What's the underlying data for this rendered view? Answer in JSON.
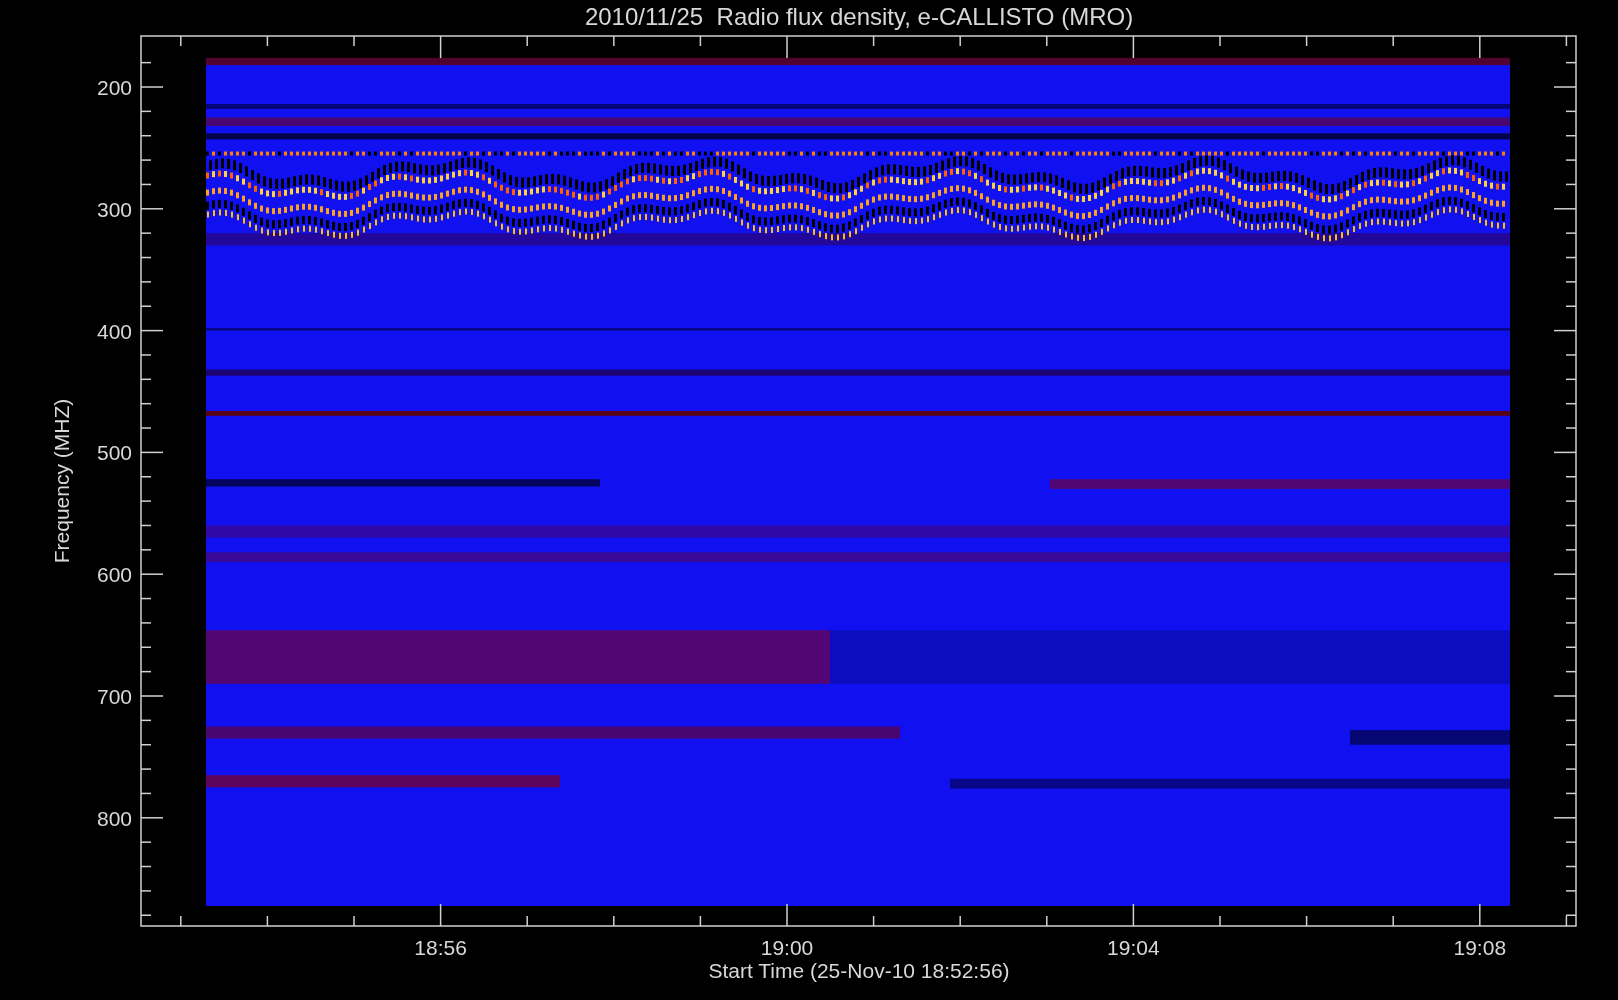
{
  "plot": {
    "title": "2010/11/25  Radio flux density, e-CALLISTO (MRO)",
    "y_axis": {
      "label": "Frequency (MHZ)",
      "ticks": [
        "200",
        "300",
        "400",
        "500",
        "600",
        "700",
        "800"
      ]
    },
    "x_axis": {
      "label": "Start Time (25-Nov-10 18:52:56)",
      "ticks": [
        "18:56",
        "19:00",
        "19:04",
        "19:08"
      ]
    }
  }
}
